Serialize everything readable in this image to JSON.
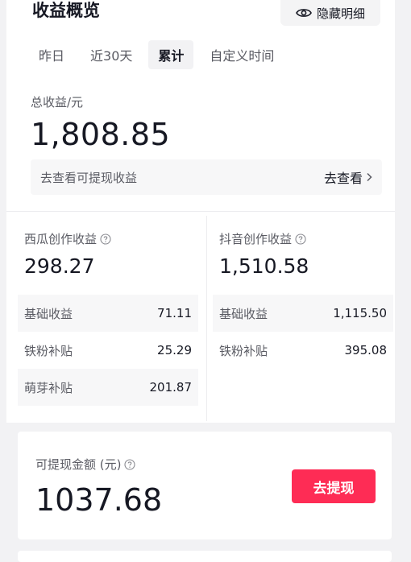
{
  "overview": {
    "title": "收益概览",
    "hide_label": "隐藏明细",
    "tabs": [
      {
        "label": "昨日",
        "active": false
      },
      {
        "label": "近30天",
        "active": false
      },
      {
        "label": "累计",
        "active": true
      },
      {
        "label": "自定义时间",
        "active": false
      }
    ],
    "total_label": "总收益/元",
    "total_value": "1,808.85",
    "check_label": "去查看可提现收益",
    "check_link": "去查看"
  },
  "xigua": {
    "title": "西瓜创作收益",
    "value": "298.27",
    "rows": [
      {
        "label": "基础收益",
        "value": "71.11"
      },
      {
        "label": "铁粉补贴",
        "value": "25.29"
      },
      {
        "label": "萌芽补贴",
        "value": "201.87"
      }
    ]
  },
  "douyin": {
    "title": "抖音创作收益",
    "value": "1,510.58",
    "rows": [
      {
        "label": "基础收益",
        "value": "1,115.50"
      },
      {
        "label": "铁粉补贴",
        "value": "395.08"
      }
    ]
  },
  "withdraw": {
    "label": "可提现金额 (元)",
    "value": "1037.68",
    "button": "去提现"
  },
  "colors": {
    "accent": "#fe2c55",
    "text_primary": "#161823",
    "text_secondary": "#5a5b63",
    "background": "#f2f2f4"
  }
}
